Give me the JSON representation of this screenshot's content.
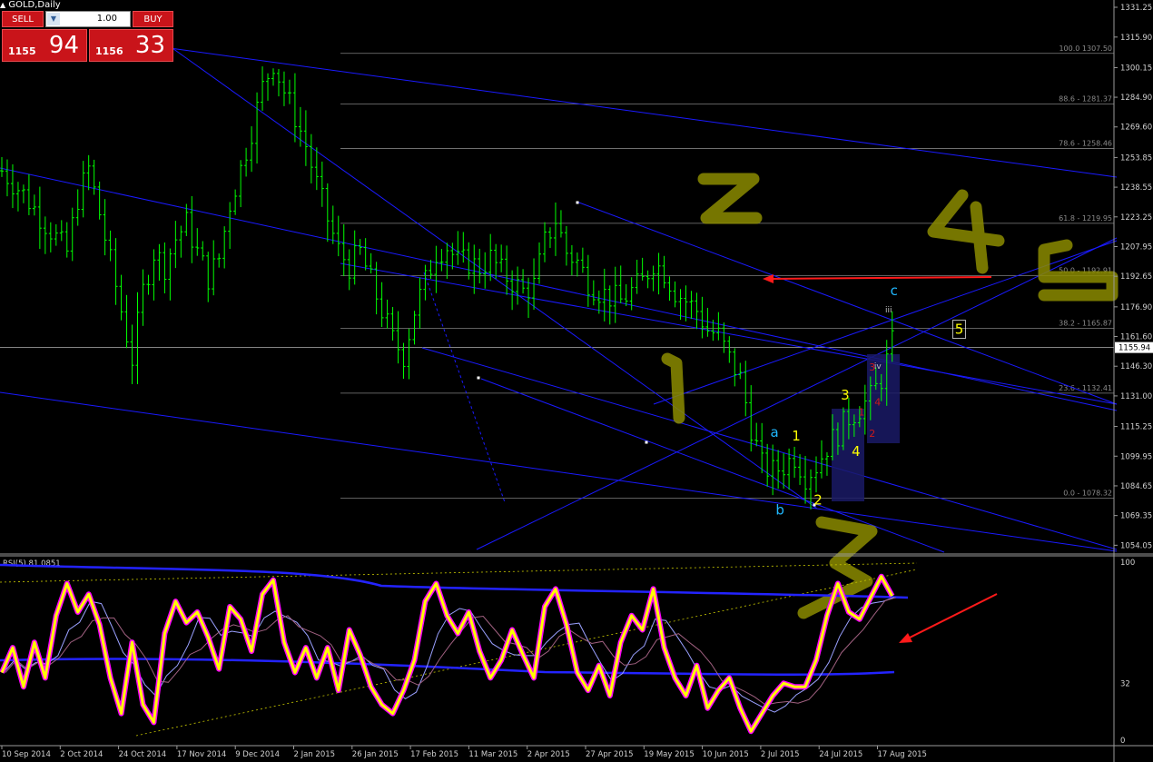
{
  "window": {
    "title": "GOLD,Daily"
  },
  "trade_panel": {
    "sell_label": "SELL",
    "buy_label": "BUY",
    "lot_value": "1.00",
    "sell_small": "1155",
    "sell_big": "94",
    "buy_small": "1156",
    "buy_big": "33"
  },
  "colors": {
    "background": "#000000",
    "candles": "#00ff00",
    "trendlines": "#1a1aff",
    "rsi_main": "#ffff00",
    "rsi_glow": "#ff00ff",
    "annotation_highlighter": "#8b8b00",
    "arrow": "#ff1a1a",
    "grid_level": "#7f7f7f"
  },
  "chart_data": {
    "type": "candlestick",
    "symbol": "GOLD",
    "timeframe": "Daily",
    "current_price": 1155.94,
    "ylim": [
      1050,
      1335
    ],
    "y_ticks": [
      "1331.25",
      "1315.90",
      "1300.15",
      "1284.90",
      "1269.60",
      "1253.85",
      "1238.55",
      "1223.25",
      "1207.95",
      "1192.65",
      "1176.90",
      "1161.60",
      "1146.30",
      "1131.00",
      "1115.25",
      "1099.95",
      "1084.65",
      "1069.35",
      "1054.05"
    ],
    "x_ticks": [
      "10 Sep 2014",
      "2 Oct 2014",
      "24 Oct 2014",
      "17 Nov 2014",
      "9 Dec 2014",
      "2 Jan 2015",
      "26 Jan 2015",
      "17 Feb 2015",
      "11 Mar 2015",
      "2 Apr 2015",
      "27 Apr 2015",
      "19 May 2015",
      "10 Jun 2015",
      "2 Jul 2015",
      "24 Jul 2015",
      "17 Aug 2015"
    ],
    "fib_levels": [
      {
        "label": "100.0 1307.50",
        "price": 1307.5
      },
      {
        "label": "88.6 - 1281.37",
        "price": 1281.37
      },
      {
        "label": "78.6 - 1258.46",
        "price": 1258.46
      },
      {
        "label": "61.8 - 1219.95",
        "price": 1219.95
      },
      {
        "label": "50.0 - 1192.91",
        "price": 1192.91
      },
      {
        "label": "38.2 - 1165.87",
        "price": 1165.87
      },
      {
        "label": "23.6 - 1132.41",
        "price": 1132.41
      },
      {
        "label": "0.0 - 1078.32",
        "price": 1078.32
      }
    ],
    "close_path": [
      [
        0,
        1247
      ],
      [
        4,
        1235
      ],
      [
        8,
        1220
      ],
      [
        12,
        1205
      ],
      [
        14,
        1233
      ],
      [
        16,
        1248
      ],
      [
        18,
        1225
      ],
      [
        20,
        1200
      ],
      [
        22,
        1175
      ],
      [
        24,
        1150
      ],
      [
        26,
        1185
      ],
      [
        28,
        1205
      ],
      [
        30,
        1198
      ],
      [
        32,
        1212
      ],
      [
        34,
        1220
      ],
      [
        36,
        1205
      ],
      [
        38,
        1192
      ],
      [
        40,
        1202
      ],
      [
        42,
        1230
      ],
      [
        44,
        1248
      ],
      [
        46,
        1268
      ],
      [
        48,
        1290
      ],
      [
        50,
        1303
      ],
      [
        52,
        1288
      ],
      [
        54,
        1275
      ],
      [
        56,
        1260
      ],
      [
        58,
        1240
      ],
      [
        60,
        1222
      ],
      [
        62,
        1206
      ],
      [
        64,
        1198
      ],
      [
        66,
        1205
      ],
      [
        68,
        1190
      ],
      [
        70,
        1175
      ],
      [
        72,
        1160
      ],
      [
        74,
        1152
      ],
      [
        76,
        1175
      ],
      [
        78,
        1190
      ],
      [
        80,
        1205
      ],
      [
        82,
        1208
      ],
      [
        84,
        1200
      ],
      [
        86,
        1200
      ],
      [
        88,
        1197
      ],
      [
        90,
        1202
      ],
      [
        92,
        1195
      ],
      [
        94,
        1190
      ],
      [
        96,
        1185
      ],
      [
        98,
        1188
      ],
      [
        100,
        1210
      ],
      [
        102,
        1222
      ],
      [
        104,
        1205
      ],
      [
        106,
        1200
      ],
      [
        108,
        1190
      ],
      [
        110,
        1185
      ],
      [
        112,
        1182
      ],
      [
        114,
        1180
      ],
      [
        116,
        1185
      ],
      [
        118,
        1190
      ],
      [
        120,
        1200
      ],
      [
        122,
        1195
      ],
      [
        124,
        1185
      ],
      [
        126,
        1180
      ],
      [
        128,
        1175
      ],
      [
        130,
        1165
      ],
      [
        132,
        1162
      ],
      [
        134,
        1150
      ],
      [
        136,
        1140
      ],
      [
        138,
        1115
      ],
      [
        140,
        1095
      ],
      [
        142,
        1092
      ],
      [
        144,
        1095
      ],
      [
        146,
        1100
      ],
      [
        148,
        1090
      ],
      [
        150,
        1095
      ],
      [
        152,
        1105
      ],
      [
        154,
        1112
      ],
      [
        156,
        1120
      ],
      [
        158,
        1125
      ],
      [
        160,
        1130
      ],
      [
        162,
        1140
      ],
      [
        164,
        1158
      ]
    ],
    "swing_labels": [
      {
        "text": "a",
        "color": "#20b8ff",
        "day": 142,
        "price": 1110
      },
      {
        "text": "b",
        "color": "#20b8ff",
        "day": 143,
        "price": 1070
      },
      {
        "text": "c",
        "color": "#20b8ff",
        "day": 164,
        "price": 1183
      },
      {
        "text": "1",
        "color": "#ffff00",
        "day": 146,
        "price": 1108
      },
      {
        "text": "2",
        "color": "#ffff00",
        "day": 150,
        "price": 1075
      },
      {
        "text": "3",
        "color": "#ffff00",
        "day": 155,
        "price": 1129
      },
      {
        "text": "4",
        "color": "#ffff00",
        "day": 157,
        "price": 1100
      },
      {
        "text": "5",
        "color": "#ffff00",
        "day": 176,
        "price": 1163
      },
      {
        "text": "iii",
        "color": "#c0c0c0",
        "day": 163,
        "price": 1174
      },
      {
        "text": "iv",
        "color": "#c0c0c0",
        "day": 161,
        "price": 1145
      },
      {
        "text": "3",
        "color": "#cc1a1a",
        "day": 160,
        "price": 1144
      },
      {
        "text": "4",
        "color": "#cc1a1a",
        "day": 161,
        "price": 1126
      },
      {
        "text": "1",
        "color": "#cc1a1a",
        "day": 158,
        "price": 1121
      },
      {
        "text": "2",
        "color": "#cc1a1a",
        "day": 160,
        "price": 1110
      }
    ],
    "rsi": {
      "label": "RSI(5) 81.0851",
      "value": 81.0851,
      "ylim": [
        0,
        100
      ],
      "y_ticks": [
        "100",
        "32",
        "0"
      ],
      "series": [
        [
          0,
          38
        ],
        [
          2,
          52
        ],
        [
          4,
          30
        ],
        [
          6,
          55
        ],
        [
          8,
          35
        ],
        [
          10,
          70
        ],
        [
          12,
          88
        ],
        [
          14,
          72
        ],
        [
          16,
          82
        ],
        [
          18,
          65
        ],
        [
          20,
          35
        ],
        [
          22,
          15
        ],
        [
          24,
          55
        ],
        [
          26,
          20
        ],
        [
          28,
          10
        ],
        [
          30,
          60
        ],
        [
          32,
          78
        ],
        [
          34,
          66
        ],
        [
          36,
          72
        ],
        [
          38,
          58
        ],
        [
          40,
          40
        ],
        [
          42,
          75
        ],
        [
          44,
          68
        ],
        [
          46,
          50
        ],
        [
          48,
          82
        ],
        [
          50,
          90
        ],
        [
          52,
          55
        ],
        [
          54,
          38
        ],
        [
          56,
          52
        ],
        [
          58,
          35
        ],
        [
          60,
          52
        ],
        [
          62,
          28
        ],
        [
          64,
          62
        ],
        [
          66,
          48
        ],
        [
          68,
          30
        ],
        [
          70,
          20
        ],
        [
          72,
          15
        ],
        [
          74,
          28
        ],
        [
          76,
          45
        ],
        [
          78,
          78
        ],
        [
          80,
          88
        ],
        [
          82,
          70
        ],
        [
          84,
          60
        ],
        [
          86,
          72
        ],
        [
          88,
          50
        ],
        [
          90,
          35
        ],
        [
          92,
          45
        ],
        [
          94,
          62
        ],
        [
          96,
          48
        ],
        [
          98,
          35
        ],
        [
          100,
          75
        ],
        [
          102,
          85
        ],
        [
          104,
          65
        ],
        [
          106,
          38
        ],
        [
          108,
          28
        ],
        [
          110,
          42
        ],
        [
          112,
          25
        ],
        [
          114,
          55
        ],
        [
          116,
          70
        ],
        [
          118,
          62
        ],
        [
          120,
          85
        ],
        [
          122,
          52
        ],
        [
          124,
          35
        ],
        [
          126,
          25
        ],
        [
          128,
          42
        ],
        [
          130,
          18
        ],
        [
          132,
          28
        ],
        [
          134,
          35
        ],
        [
          136,
          18
        ],
        [
          138,
          5
        ],
        [
          140,
          15
        ],
        [
          142,
          25
        ],
        [
          144,
          32
        ],
        [
          146,
          30
        ],
        [
          148,
          30
        ],
        [
          150,
          45
        ],
        [
          152,
          70
        ],
        [
          154,
          88
        ],
        [
          156,
          72
        ],
        [
          158,
          68
        ],
        [
          160,
          80
        ],
        [
          162,
          92
        ],
        [
          164,
          81
        ]
      ]
    }
  }
}
